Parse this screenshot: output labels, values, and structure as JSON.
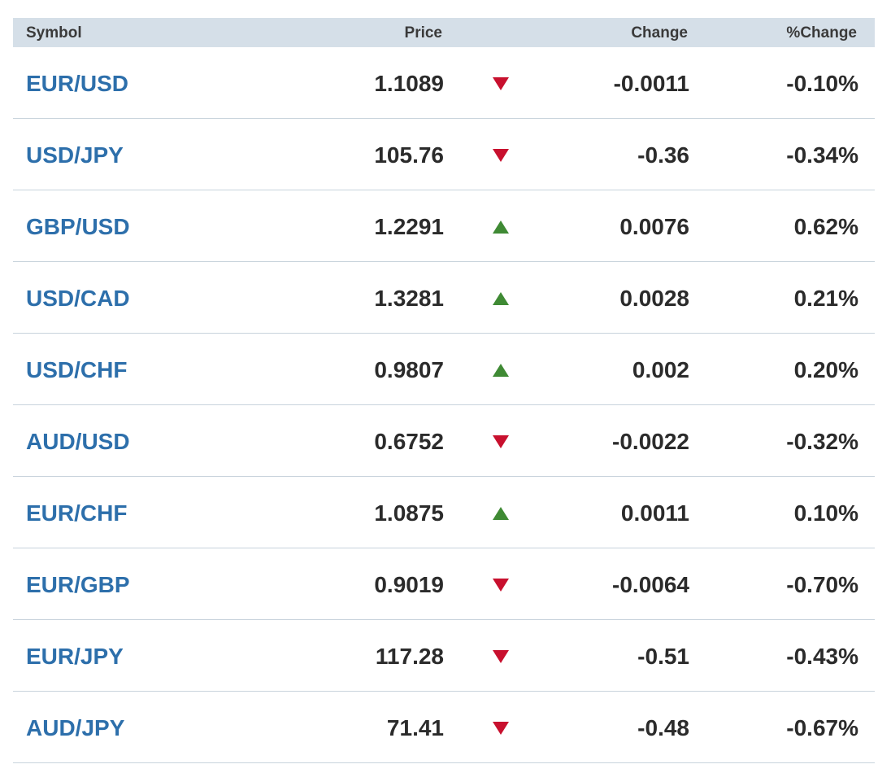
{
  "header": {
    "symbol": "Symbol",
    "price": "Price",
    "change": "Change",
    "pct_change": "%Change"
  },
  "colors": {
    "up": "#3f8a34",
    "down": "#c8102e",
    "symbol_link": "#2d6fab",
    "header_bg": "#d5dfe8"
  },
  "rows": [
    {
      "symbol": "EUR/USD",
      "price": "1.1089",
      "direction": "down",
      "change": "-0.0011",
      "pct_change": "-0.10%"
    },
    {
      "symbol": "USD/JPY",
      "price": "105.76",
      "direction": "down",
      "change": "-0.36",
      "pct_change": "-0.34%"
    },
    {
      "symbol": "GBP/USD",
      "price": "1.2291",
      "direction": "up",
      "change": "0.0076",
      "pct_change": "0.62%"
    },
    {
      "symbol": "USD/CAD",
      "price": "1.3281",
      "direction": "up",
      "change": "0.0028",
      "pct_change": "0.21%"
    },
    {
      "symbol": "USD/CHF",
      "price": "0.9807",
      "direction": "up",
      "change": "0.002",
      "pct_change": "0.20%"
    },
    {
      "symbol": "AUD/USD",
      "price": "0.6752",
      "direction": "down",
      "change": "-0.0022",
      "pct_change": "-0.32%"
    },
    {
      "symbol": "EUR/CHF",
      "price": "1.0875",
      "direction": "up",
      "change": "0.0011",
      "pct_change": "0.10%"
    },
    {
      "symbol": "EUR/GBP",
      "price": "0.9019",
      "direction": "down",
      "change": "-0.0064",
      "pct_change": "-0.70%"
    },
    {
      "symbol": "EUR/JPY",
      "price": "117.28",
      "direction": "down",
      "change": "-0.51",
      "pct_change": "-0.43%"
    },
    {
      "symbol": "AUD/JPY",
      "price": "71.41",
      "direction": "down",
      "change": "-0.48",
      "pct_change": "-0.67%"
    }
  ]
}
